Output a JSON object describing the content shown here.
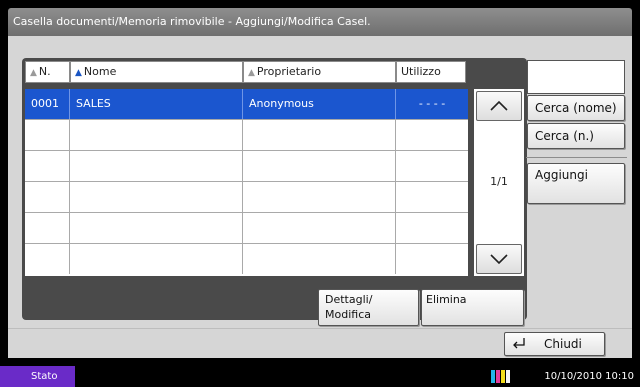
{
  "window": {
    "title": "Casella documenti/Memoria rimovibile - Aggiungi/Modifica Casel."
  },
  "table": {
    "columns": [
      "N.",
      "Nome",
      "Proprietario",
      "Utilizzo"
    ],
    "rows": [
      {
        "n": "0001",
        "nome": "SALES",
        "proprietario": "Anonymous",
        "utilizzo": "- - - -",
        "selected": true
      },
      {
        "n": "",
        "nome": "",
        "proprietario": "",
        "utilizzo": "",
        "selected": false
      },
      {
        "n": "",
        "nome": "",
        "proprietario": "",
        "utilizzo": "",
        "selected": false
      },
      {
        "n": "",
        "nome": "",
        "proprietario": "",
        "utilizzo": "",
        "selected": false
      },
      {
        "n": "",
        "nome": "",
        "proprietario": "",
        "utilizzo": "",
        "selected": false
      },
      {
        "n": "",
        "nome": "",
        "proprietario": "",
        "utilizzo": "",
        "selected": false
      }
    ],
    "page_indicator": "1/1"
  },
  "side": {
    "search_value": "",
    "search_name_label": "Cerca (nome)",
    "search_number_label": "Cerca (n.)",
    "add_label": "Aggiungi"
  },
  "actions": {
    "details_label_1": "Dettagli/",
    "details_label_2": "Modifica",
    "delete_label": "Elimina",
    "close_label": "Chiudi"
  },
  "status": {
    "label": "Stato",
    "datetime": "10/10/2010  10:10"
  },
  "colors": {
    "selection": "#1b56cf",
    "title_bar": "#7f7f7f",
    "panel": "#d6d6d6",
    "status_badge": "#6a2bc8"
  },
  "icons": {
    "sort_inactive": "triangle-up-grey",
    "sort_active": "triangle-up-blue",
    "scroll_up": "chevron-up",
    "scroll_down": "chevron-down",
    "close": "enter-return-arrow"
  }
}
